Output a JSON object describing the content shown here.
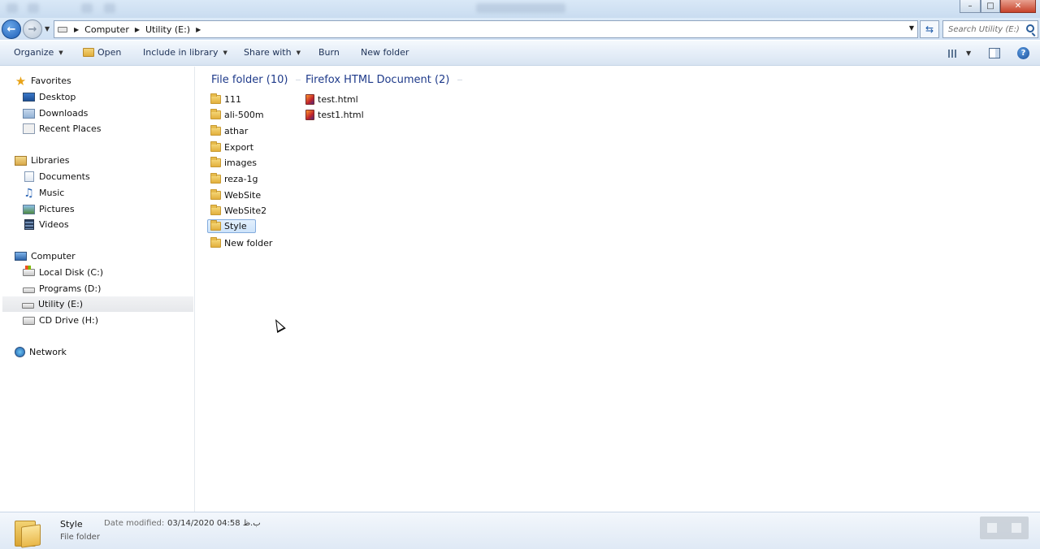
{
  "window": {
    "title": "Utility (E:)",
    "controls": {
      "minimize": "–",
      "maximize": "□",
      "close": "✕"
    }
  },
  "address": {
    "breadcrumbs": [
      "Computer",
      "Utility (E:)"
    ],
    "search_placeholder": "Search Utility (E:)"
  },
  "toolbar": {
    "organize": "Organize",
    "open": "Open",
    "include_in_library": "Include in library",
    "share_with": "Share with",
    "burn": "Burn",
    "new_folder": "New folder",
    "help": "?"
  },
  "sidebar": {
    "favorites": {
      "label": "Favorites",
      "items": [
        "Desktop",
        "Downloads",
        "Recent Places"
      ]
    },
    "libraries": {
      "label": "Libraries",
      "items": [
        "Documents",
        "Music",
        "Pictures",
        "Videos"
      ]
    },
    "computer": {
      "label": "Computer",
      "items": [
        "Local Disk (C:)",
        "Programs (D:)",
        "Utility (E:)",
        "CD Drive (H:)"
      ],
      "selected": "Utility (E:)"
    },
    "network": {
      "label": "Network"
    }
  },
  "content": {
    "groups": [
      {
        "header": "File folder (10)",
        "items": [
          "111",
          "ali-500m",
          "athar",
          "Export",
          "images",
          "reza-1g",
          "WebSite",
          "WebSite2",
          "Style",
          "New folder"
        ]
      },
      {
        "header": "Firefox HTML Document (2)",
        "items": [
          "test.html",
          "test1.html"
        ]
      }
    ],
    "selected": "Style"
  },
  "details": {
    "name": "Style",
    "type": "File folder",
    "date_label": "Date modified:",
    "date_value": "03/14/2020 04:58 ب.ظ"
  },
  "colors": {
    "accent": "#1e3a8a",
    "selection_bg": "#cde3fa",
    "selection_border": "#84acdd",
    "toolbar_bg": "#e6eef8"
  }
}
